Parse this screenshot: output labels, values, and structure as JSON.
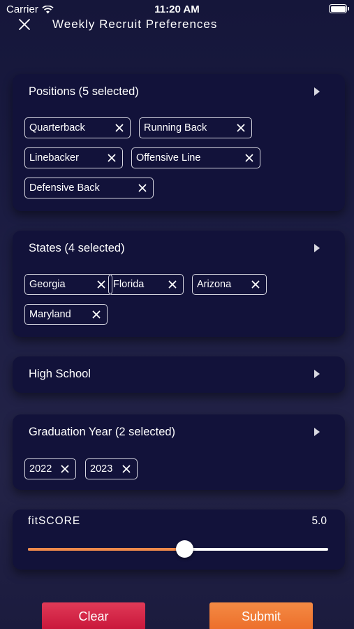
{
  "status_bar": {
    "carrier": "Carrier",
    "time": "11:20 AM"
  },
  "header": {
    "title": "Weekly Recruit Preferences",
    "close_icon": "close-icon"
  },
  "positions": {
    "title": "Positions (5 selected)",
    "chips": [
      "Quarterback",
      "Running Back",
      "Linebacker",
      "Offensive Line",
      "Defensive Back"
    ]
  },
  "states": {
    "title": "States (4 selected)",
    "chips": [
      "Georgia",
      "Florida",
      "Arizona",
      "Maryland"
    ]
  },
  "high_school": {
    "title": "High School"
  },
  "graduation_year": {
    "title": "Graduation Year (2 selected)",
    "chips": [
      "2022",
      "2023"
    ]
  },
  "fitscore": {
    "label": "fitSCORE",
    "value": "5.0",
    "slider_fraction": 0.52
  },
  "actions": {
    "clear_label": "Clear",
    "submit_label": "Submit"
  },
  "colors": {
    "accent_orange": "#f08a4b",
    "clear_red": "#d52447",
    "submit_orange": "#ef7a35",
    "card_bg": "#12123a"
  }
}
